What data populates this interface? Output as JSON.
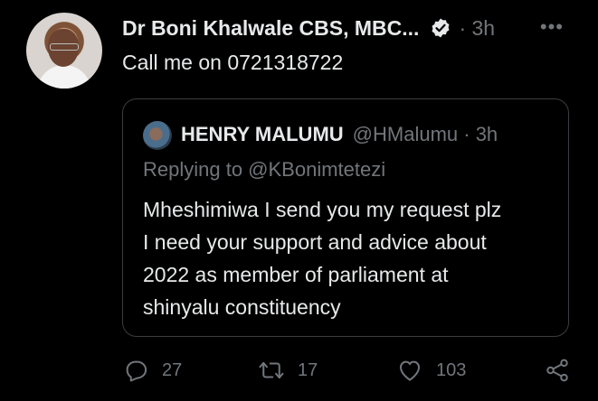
{
  "tweet": {
    "author_name": "Dr Boni Khalwale CBS, MBC...",
    "time": "· 3h",
    "text": "Call me on 0721318722"
  },
  "quoted_tweet": {
    "author_name": "HENRY MALUMU",
    "handle_time": "@HMalumu · 3h",
    "replying_to": "Replying to @KBonimtetezi",
    "lines": [
      "Mheshimiwa I send you my request plz",
      "I need your support and advice about",
      "2022 as member of parliament at",
      "shinyalu constituency"
    ]
  },
  "actions": {
    "replies": "27",
    "retweets": "17",
    "likes": "103"
  },
  "icons": {
    "more": "more-horizontal-icon",
    "verified": "verified-badge-icon",
    "reply": "reply-icon",
    "retweet": "retweet-icon",
    "like": "heart-icon",
    "share": "share-icon"
  },
  "colors": {
    "background": "#000000",
    "text": "#e7e9ea",
    "secondary": "#71767b",
    "border": "#3a3d41"
  }
}
